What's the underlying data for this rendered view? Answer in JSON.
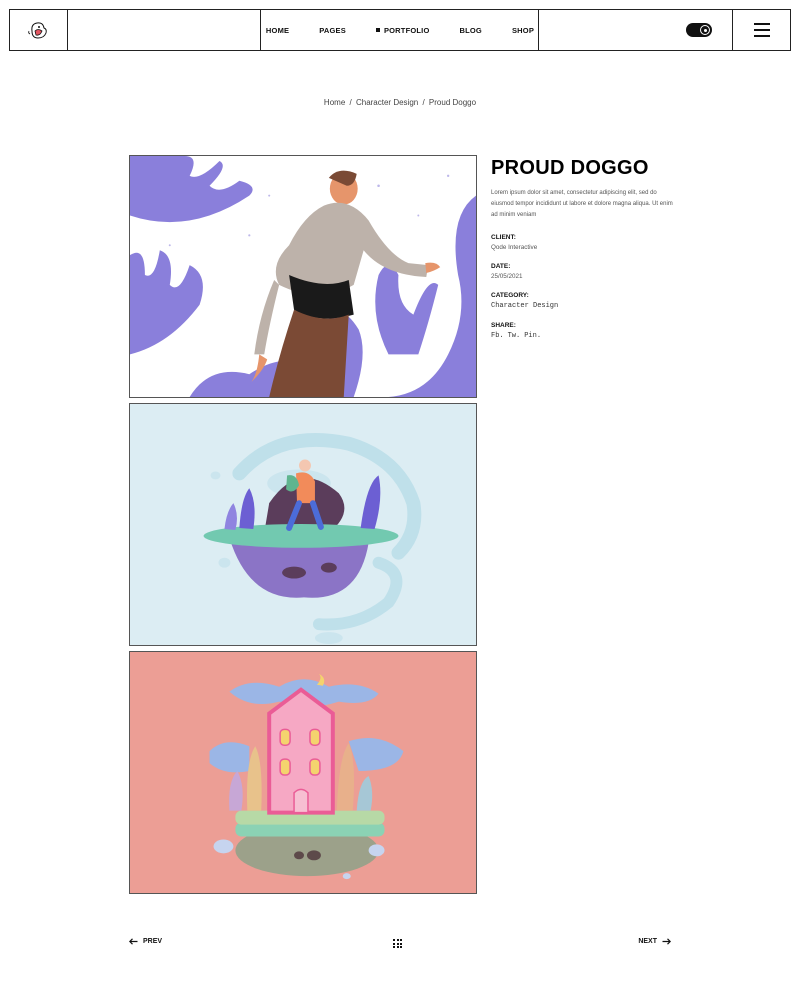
{
  "header": {
    "logo_icon": "dog-logo-icon",
    "nav": [
      {
        "label": "HOME",
        "active": false
      },
      {
        "label": "PAGES",
        "active": false
      },
      {
        "label": "PORTFOLIO",
        "active": true
      },
      {
        "label": "BLOG",
        "active": false
      },
      {
        "label": "SHOP",
        "active": false
      }
    ],
    "toggle_icon": "eye-toggle-icon",
    "menu_icon": "hamburger-icon"
  },
  "breadcrumb": {
    "home": "Home",
    "category": "Character Design",
    "current": "Proud Doggo",
    "separator": "/"
  },
  "project": {
    "title": "PROUD DOGGO",
    "description": "Lorem ipsum dolor sit amet, consectetur adipiscing elit, sed do eiusmod tempor incididunt ut labore et dolore magna aliqua. Ut enim ad minim veniam",
    "client_label": "CLIENT:",
    "client": "Qode Interactive",
    "date_label": "DATE:",
    "date": "25/05/2021",
    "category_label": "CATEGORY:",
    "category": "Character Design",
    "share_label": "SHARE:",
    "share_links": [
      "Fb.",
      "Tw.",
      "Pin."
    ]
  },
  "colors": {
    "purple": "#8a7fdb",
    "light_blue": "#dcedf3",
    "salmon": "#ec9e95",
    "pink_house": "#f6a8c4",
    "teal": "#6fcfb6"
  },
  "pager": {
    "prev": "PREV",
    "next": "NEXT",
    "grid_icon": "grid-icon"
  }
}
